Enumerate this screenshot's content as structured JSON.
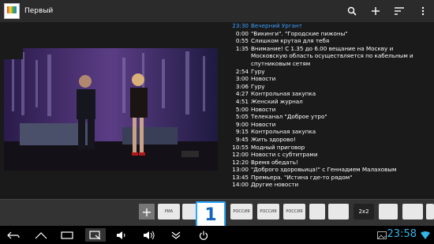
{
  "app": {
    "title": "Первый"
  },
  "toolbar": {
    "icons": [
      "search-icon",
      "add-icon",
      "sort-icon",
      "menu-icon"
    ]
  },
  "epg": [
    {
      "time": "23:30",
      "title": "Вечерний Ургант",
      "current": true
    },
    {
      "time": "0:00",
      "title": "\"Викинги\". \"Городские пижоны\""
    },
    {
      "time": "0:55",
      "title": "Слишком крутая для тебя"
    },
    {
      "time": "1:35",
      "title": "Внимание! С 1.35 до 6.00 вещание на Москву и Московскую область осуществляется по кабельным и спутниковым сетям"
    },
    {
      "time": "2:54",
      "title": "Гуру"
    },
    {
      "time": "3:00",
      "title": "Новости"
    },
    {
      "time": "3:06",
      "title": "Гуру"
    },
    {
      "time": "4:27",
      "title": "Контрольная закупка"
    },
    {
      "time": "4:51",
      "title": "Женский журнал"
    },
    {
      "time": "5:00",
      "title": "Новости"
    },
    {
      "time": "5:05",
      "title": "Телеканал \"Доброе утро\""
    },
    {
      "time": "9:00",
      "title": "Новости"
    },
    {
      "time": "9:15",
      "title": "Контрольная закупка"
    },
    {
      "time": "9:45",
      "title": "Жить здорово!"
    },
    {
      "time": "10:55",
      "title": "Модный приговор"
    },
    {
      "time": "12:00",
      "title": "Новости с субтитрами"
    },
    {
      "time": "12:20",
      "title": "Время обедать!"
    },
    {
      "time": "13:00",
      "title": "\"Доброго здоровьица!\" с Геннадием Малаховым"
    },
    {
      "time": "13:45",
      "title": "Премьера. \"Истина где-то рядом\""
    },
    {
      "time": "14:00",
      "title": "Другие новости"
    }
  ],
  "channels": {
    "add_label": "+",
    "items": [
      {
        "label": "РИА",
        "icon": "ria-icon"
      },
      {
        "label": "",
        "icon": "channel-logo-icon"
      },
      {
        "label": "1",
        "icon": "perviy-icon",
        "active": true
      },
      {
        "label": "РОССИЯ",
        "icon": "rossiya1-icon"
      },
      {
        "label": "РОССИЯ",
        "icon": "rossiya2-icon"
      },
      {
        "label": "РОССИЯ",
        "icon": "rossiya24-icon"
      },
      {
        "label": "",
        "icon": "channel-logo-icon"
      },
      {
        "label": "",
        "icon": "channel-logo-icon"
      },
      {
        "label": "2x2",
        "icon": "2x2-icon"
      },
      {
        "label": "",
        "icon": "channel-logo-icon"
      },
      {
        "label": "",
        "icon": "channel-logo-icon"
      },
      {
        "label": "",
        "icon": "channel-logo-icon"
      }
    ]
  },
  "statusbar": {
    "time": "23:58"
  },
  "colors": {
    "accent": "#3aa0ff",
    "active_border": "#29a8ff",
    "clock": "#33b5e5"
  }
}
